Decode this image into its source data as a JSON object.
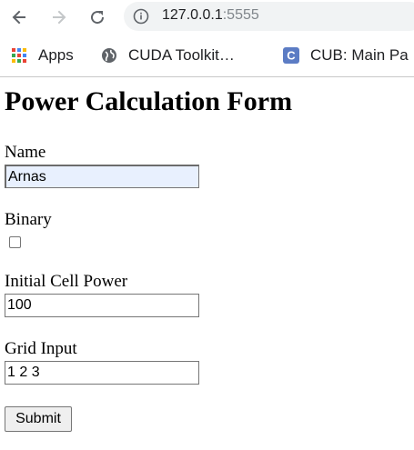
{
  "browser": {
    "url_host": "127.0.0.1",
    "url_port": ":5555"
  },
  "bookmarks": [
    {
      "label": "Apps",
      "icon": "apps-grid-icon"
    },
    {
      "label": "CUDA Toolkit…",
      "icon": "globe-icon"
    },
    {
      "label": "CUB: Main Pa",
      "icon": "c-logo-icon"
    }
  ],
  "form": {
    "title": "Power Calculation Form",
    "name_label": "Name",
    "name_value": "Arnas",
    "binary_label": "Binary",
    "binary_checked": false,
    "power_label": "Initial Cell Power",
    "power_value": "100",
    "grid_label": "Grid Input",
    "grid_value": "1 2 3",
    "submit_label": "Submit"
  }
}
